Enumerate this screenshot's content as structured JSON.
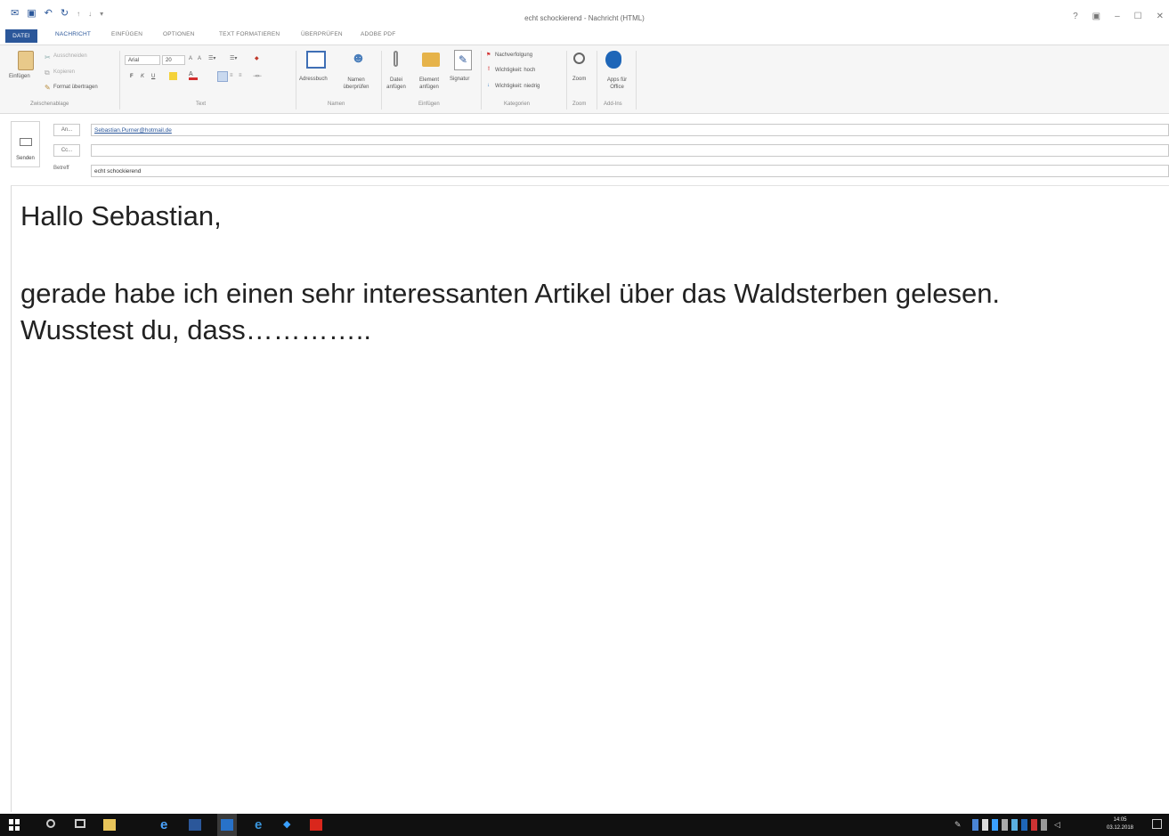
{
  "window": {
    "title": "echt schockierend - Nachricht (HTML)",
    "qat_icons": [
      "save-icon",
      "undo-icon",
      "redo-icon",
      "up-icon",
      "down-icon"
    ],
    "controls": [
      "?",
      "▣",
      "–",
      "☐",
      "✕"
    ]
  },
  "ribbon": {
    "tabs": [
      "DATEI",
      "NACHRICHT",
      "EINFÜGEN",
      "OPTIONEN",
      "TEXT FORMATIEREN",
      "ÜBERPRÜFEN",
      "ADOBE PDF"
    ],
    "active_tab": "NACHRICHT",
    "clipboard": {
      "paste": "Einfügen",
      "cut": "Ausschneiden",
      "copy": "Kopieren",
      "format_painter": "Format übertragen",
      "group": "Zwischenablage"
    },
    "text": {
      "font": "Arial",
      "size": "20",
      "bold": "F",
      "italic": "K",
      "underline": "U",
      "group": "Text"
    },
    "names": {
      "address_book": "Adressbuch",
      "check_names": "Namen überprüfen",
      "group": "Namen"
    },
    "include": {
      "attach_file": "Datei anfügen",
      "attach_item": "Element anfügen",
      "signature": "Signatur",
      "group": "Einfügen"
    },
    "tags": {
      "follow_up": "Nachverfolgung",
      "high_importance": "Wichtigkeit: hoch",
      "low_importance": "Wichtigkeit: niedrig",
      "group": "Kategorien"
    },
    "zoom": {
      "zoom": "Zoom",
      "group": "Zoom"
    },
    "addins": {
      "apps": "Apps für Office",
      "group": "Add-Ins"
    }
  },
  "header": {
    "send": "Senden",
    "to_button": "An...",
    "cc_button": "Cc...",
    "to_value": "Sebastian.Purner@hotmail.de",
    "cc_value": "",
    "subject_label": "Betreff",
    "subject_value": "echt schockierend"
  },
  "body": {
    "line1": "Hallo Sebastian,",
    "line2": "gerade habe ich einen sehr interessanten Artikel über das Waldsterben gelesen.",
    "line3": "Wusstest du, dass…………..",
    "color": "#222222"
  },
  "taskbar": {
    "icons": [
      "windows-start-icon",
      "search-icon",
      "task-view-icon",
      "file-explorer-icon",
      "internet-explorer-icon",
      "word-icon",
      "outlook-icon",
      "edge-icon",
      "dropbox-icon",
      "acrobat-icon"
    ],
    "time": "14:05",
    "date": "03.12.2018"
  },
  "colors": {
    "accent": "#2b579a",
    "taskbar": "#101010"
  }
}
